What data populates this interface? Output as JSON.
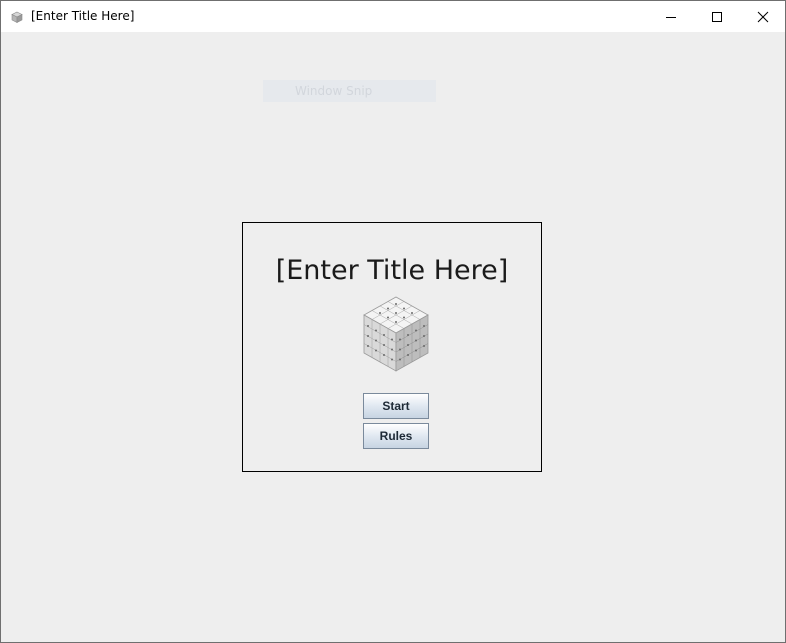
{
  "window": {
    "title": "[Enter Title Here]",
    "app_icon": "app-cube-icon",
    "controls": [
      "minimize-icon",
      "maximize-icon",
      "close-icon"
    ]
  },
  "overlay": {
    "label": "Window Snip"
  },
  "menu": {
    "title": "[Enter Title Here]",
    "logo": "letter-cube-logo",
    "start_label": "Start",
    "rules_label": "Rules"
  }
}
